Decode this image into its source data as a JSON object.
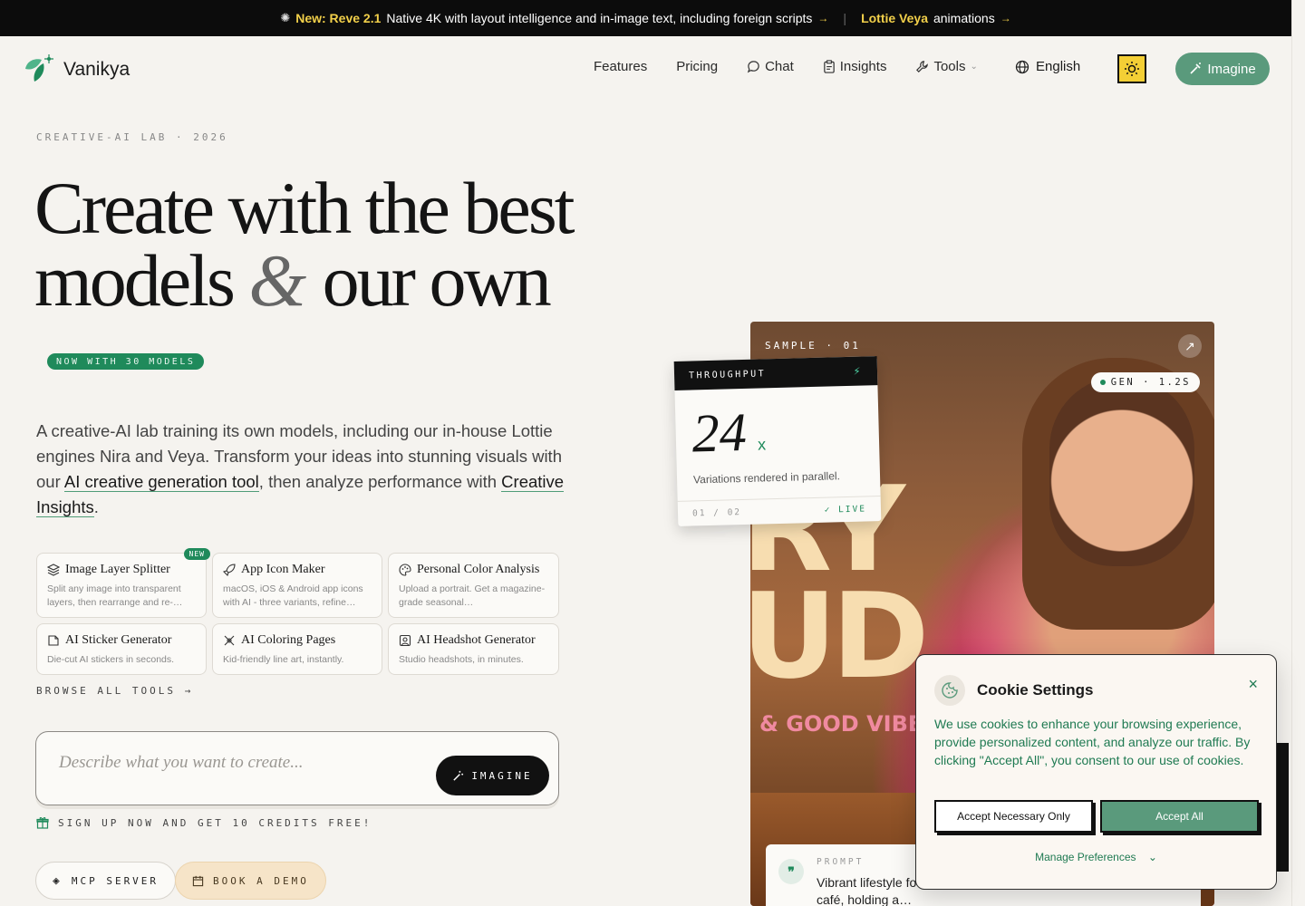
{
  "announce": {
    "new_label": "New: Reve 2.1",
    "new_text": "Native 4K with layout intelligence and in-image text, including foreign scripts",
    "lottie_label": "Lottie Veya",
    "lottie_text": "animations",
    "arrow": "→"
  },
  "header": {
    "brand": "Vanikya",
    "nav": [
      "Features",
      "Pricing",
      "Chat",
      "Insights",
      "Tools"
    ],
    "language": "English",
    "cta": "Imagine"
  },
  "hero": {
    "eyebrow": "CREATIVE-AI LAB · 2026",
    "title_line1": "Create with the best",
    "title_line2_a": "models",
    "title_amp": "&",
    "title_line2_b": "our own",
    "models_badge": "NOW WITH 30 MODELS",
    "lead_1": "A creative-AI lab training its own models, including our in-house Lottie engines Nira and Veya. Transform your ideas into stunning visuals with our ",
    "lead_link1": "AI creative generation tool",
    "lead_2": ", then analyze performance with ",
    "lead_link2": "Creative Insights",
    "lead_3": "."
  },
  "tools": [
    {
      "title": "Image Layer Splitter",
      "desc": "Split any image into transparent layers, then rearrange and re-…",
      "badge": "NEW",
      "icon": "layers-icon"
    },
    {
      "title": "App Icon Maker",
      "desc": "macOS, iOS & Android app icons with AI - three variants, refine…",
      "icon": "rocket-icon"
    },
    {
      "title": "Personal Color Analysis",
      "desc": "Upload a portrait. Get a magazine-grade seasonal…",
      "icon": "palette-icon"
    },
    {
      "title": "AI Sticker Generator",
      "desc": "Die-cut AI stickers in seconds.",
      "icon": "sticker-icon"
    },
    {
      "title": "AI Coloring Pages",
      "desc": "Kid-friendly line art, instantly.",
      "icon": "brush-icon"
    },
    {
      "title": "AI Headshot Generator",
      "desc": "Studio headshots, in minutes.",
      "icon": "portrait-icon"
    }
  ],
  "browse": "BROWSE ALL TOOLS →",
  "prompt": {
    "placeholder": "Describe what you want to create...",
    "button": "IMAGINE",
    "signup": "SIGN UP NOW AND GET 10 CREDITS FREE!"
  },
  "pills": {
    "mcp": "MCP SERVER",
    "demo": "BOOK A DEMO"
  },
  "sample": {
    "label": "SAMPLE · 01",
    "gen": "GEN · 1.2S",
    "graffiti": "RY\nUD",
    "vibes": "& GOOD VIBES",
    "prompt_label": "PROMPT",
    "prompt_text": "Vibrant lifestyle fo… hot pink blazer sitting inside a colorful trendy café, holding a…"
  },
  "throughput": {
    "label": "THROUGHPUT",
    "value": "24",
    "unit": "x",
    "caption": "Variations rendered in parallel.",
    "page": "01 / 02",
    "live": "✓ LIVE"
  },
  "cookie": {
    "title": "Cookie Settings",
    "body": "We use cookies to enhance your browsing experience, provide personalized content, and analyze our traffic. By clicking \"Accept All\", you consent to our use of cookies.",
    "accept_necessary": "Accept Necessary Only",
    "accept_all": "Accept All",
    "manage": "Manage Preferences",
    "close": "×"
  },
  "colors": {
    "accent_green": "#1f8a5b",
    "button_green": "#5a9a7c",
    "sun_yellow": "#f4cf35",
    "highlight": "#f2d04a"
  }
}
